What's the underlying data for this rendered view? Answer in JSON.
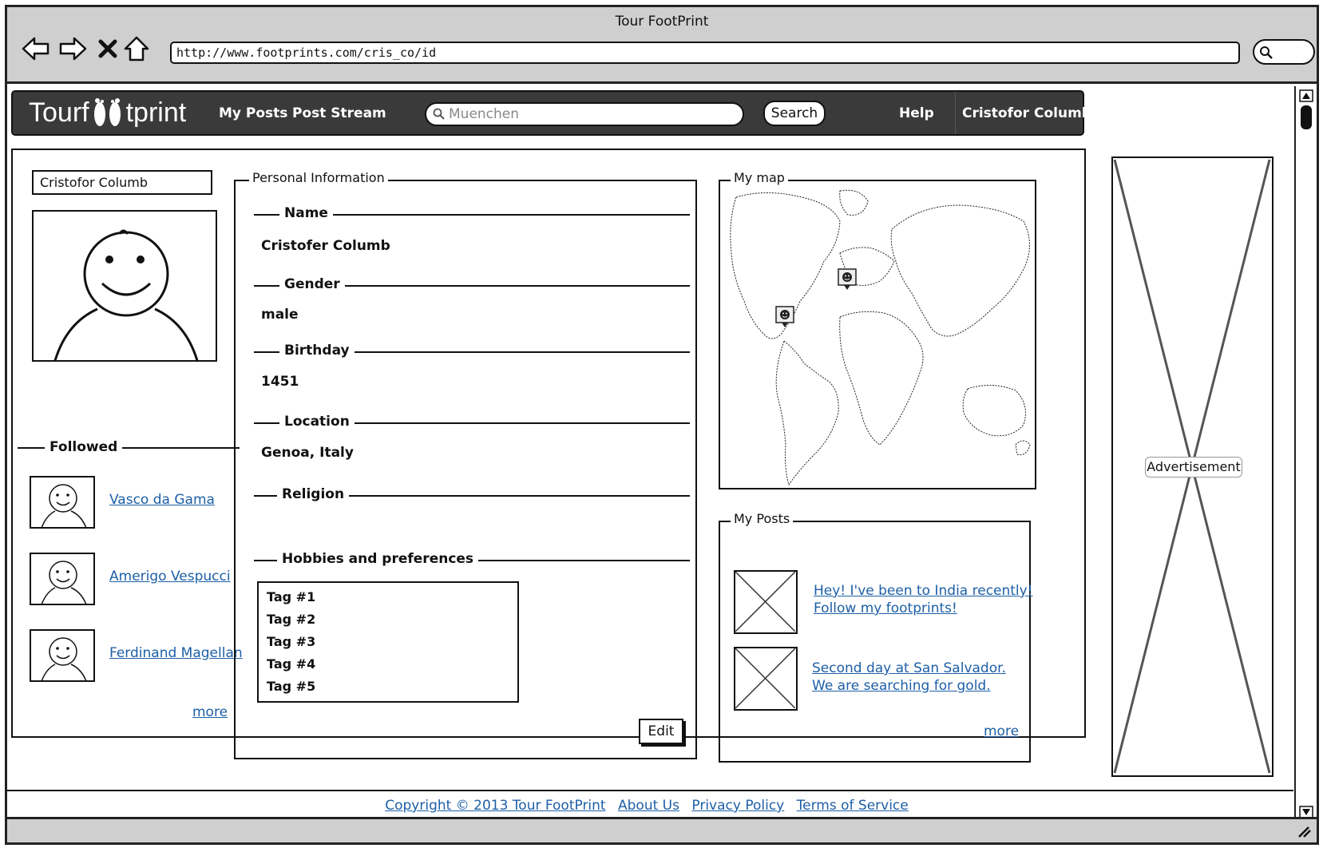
{
  "browser": {
    "title": "Tour FootPrint",
    "url": "http://www.footprints.com/cris_co/id",
    "icons": [
      "back-arrow-icon",
      "forward-arrow-icon",
      "stop-icon",
      "home-icon",
      "search-icon"
    ]
  },
  "header": {
    "logo_left": "Tourf",
    "logo_right": "tprint",
    "nav": [
      "My Posts",
      "Post Stream"
    ],
    "search_placeholder": "Muenchen",
    "search_button": "Search",
    "help": "Help",
    "user": "Cristofor Columb",
    "colors": {
      "bar": "#3a3a3a",
      "text": "#ffffff"
    }
  },
  "profile": {
    "name_field": "Cristofor Columb"
  },
  "followed": {
    "title": "Followed",
    "people": [
      "Vasco da Gama",
      "Amerigo Vespucci",
      "Ferdinand Magellan"
    ],
    "more": "more"
  },
  "personal": {
    "title": "Personal Information",
    "fields": [
      {
        "label": "Name",
        "value": "Cristofer Columb"
      },
      {
        "label": "Gender",
        "value": "male"
      },
      {
        "label": "Birthday",
        "value": "1451"
      },
      {
        "label": "Location",
        "value": "Genoa, Italy"
      },
      {
        "label": "Religion",
        "value": ""
      }
    ],
    "hobbies_label": "Hobbies and preferences",
    "tags": [
      "Tag #1",
      "Tag #2",
      "Tag #3",
      "Tag #4",
      "Tag #5"
    ],
    "edit": "Edit"
  },
  "map": {
    "title": "My map"
  },
  "posts": {
    "title": "My Posts",
    "items": [
      {
        "line1": "Hey! I've been to India recently!",
        "line2": "Follow my footprints!"
      },
      {
        "line1": "Second day at San Salvador.",
        "line2": "We are searching for gold."
      }
    ],
    "more": "more"
  },
  "ad": {
    "label": "Advertisement"
  },
  "footer": {
    "links": [
      "Copyright © 2013 Tour FootPrint",
      "About Us",
      "Privacy Policy",
      "Terms of Service"
    ],
    "link_color": "#1d5fa6"
  }
}
